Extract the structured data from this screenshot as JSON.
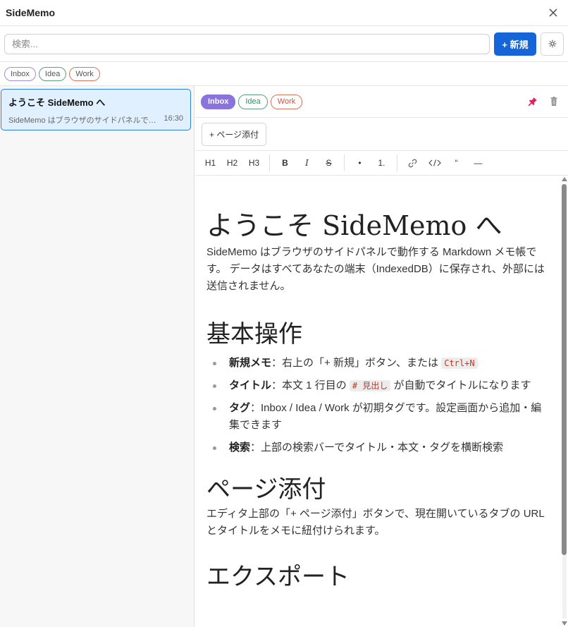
{
  "app": {
    "title": "SideMemo"
  },
  "search": {
    "placeholder": "検索...",
    "new_label": "+ 新規"
  },
  "filter_tags": [
    "Inbox",
    "Idea",
    "Work"
  ],
  "note": {
    "title": "ようこそ SideMemo へ",
    "preview": "SideMemo はブラウザのサイドパネルで動作する Markdown メモ帳です。",
    "time": "16:30"
  },
  "editor": {
    "tags": [
      "Inbox",
      "Idea",
      "Work"
    ],
    "attach_label": "+ ページ添付",
    "toolbar": {
      "h1": "H1",
      "h2": "H2",
      "h3": "H3",
      "bold": "B",
      "italic": "I",
      "strike": "S",
      "bullet": "•",
      "ordered": "1.",
      "quote": "“",
      "hr": "—"
    }
  },
  "doc": {
    "h1": "ようこそ SideMemo へ",
    "p1": "SideMemo はブラウザのサイドパネルで動作する Markdown メモ帳です。 データはすべてあなたの端末（IndexedDB）に保存され、外部には送信されません。",
    "h2_basic": "基本操作",
    "list": [
      {
        "label": "新規メモ",
        "pre": "：右上の「+ 新規」ボタン、または ",
        "code": "Ctrl+N",
        "post": ""
      },
      {
        "label": "タイトル",
        "pre": "：本文 1 行目の ",
        "code": "# 見出し",
        "post": " が自動でタイトルになります"
      },
      {
        "label": "タグ",
        "pre": "：Inbox / Idea / Work が初期タグです。設定画面から追加・編集できます",
        "code": "",
        "post": ""
      },
      {
        "label": "検索",
        "pre": "：上部の検索バーでタイトル・本文・タグを横断検索",
        "code": "",
        "post": ""
      }
    ],
    "h2_attach": "ページ添付",
    "p_attach": "エディタ上部の「+ ページ添付」ボタンで、現在開いているタブの URL とタイトルをメモに紐付けられます。",
    "h2_export": "エクスポート"
  },
  "colors": {
    "accent": "#1565d8",
    "inbox": "#8a73dc",
    "idea": "#5aa07a",
    "work": "#d9735a",
    "selected_bg": "#e1f0fe"
  }
}
